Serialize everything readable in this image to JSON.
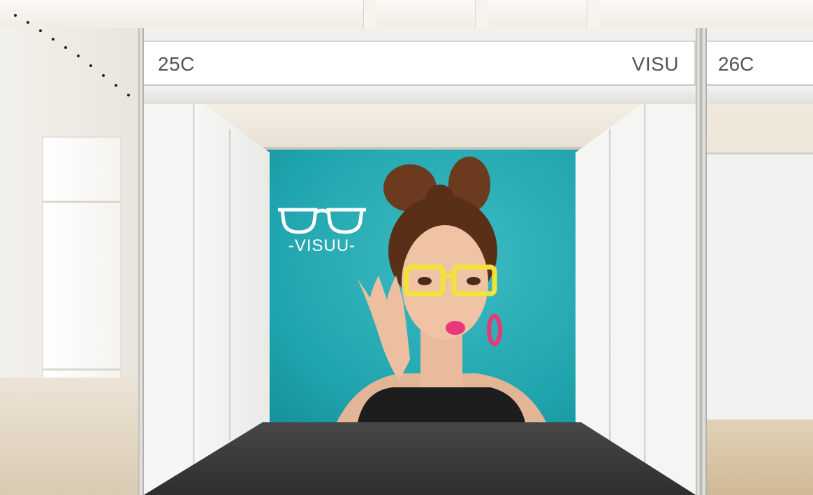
{
  "booths": [
    {
      "number": "25C",
      "company": "VISU"
    },
    {
      "number": "26C"
    }
  ],
  "graphic": {
    "logo_text": "-VISUU-",
    "background_color": "#1fa3ac"
  },
  "colors": {
    "frame": "#c9c7c3",
    "floor": "#3d3d3d",
    "header": "#ffffff",
    "text": "#555555",
    "glasses_accent": "#f3e23a",
    "earring_accent": "#e8387a"
  }
}
